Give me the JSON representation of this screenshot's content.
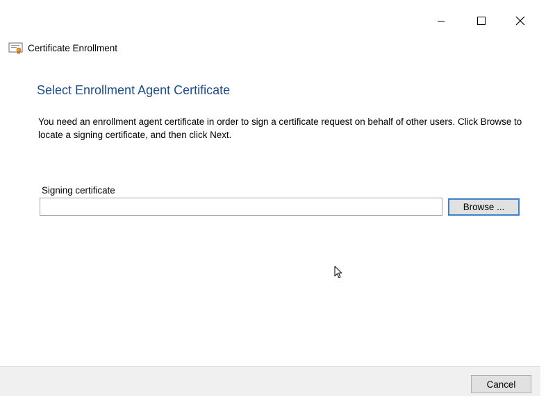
{
  "window": {
    "caption_buttons": {
      "minimize_icon": "minimize-icon",
      "maximize_icon": "maximize-icon",
      "close_icon": "close-icon"
    }
  },
  "wizard": {
    "title": "Certificate Enrollment",
    "icon": "certificate-icon"
  },
  "page": {
    "heading": "Select Enrollment Agent Certificate",
    "description": "You need an enrollment agent certificate in order to sign a certificate request on behalf of other users. Click Browse to locate a signing certificate, and then click Next."
  },
  "signing_certificate": {
    "label": "Signing certificate",
    "value": "",
    "browse_label": "Browse ..."
  },
  "footer": {
    "cancel_label": "Cancel"
  },
  "colors": {
    "heading": "#1e4e8c",
    "button_focus_border": "#3c7fce",
    "button_face": "#e1e1e1",
    "footer_bg": "#f0f0f0"
  }
}
